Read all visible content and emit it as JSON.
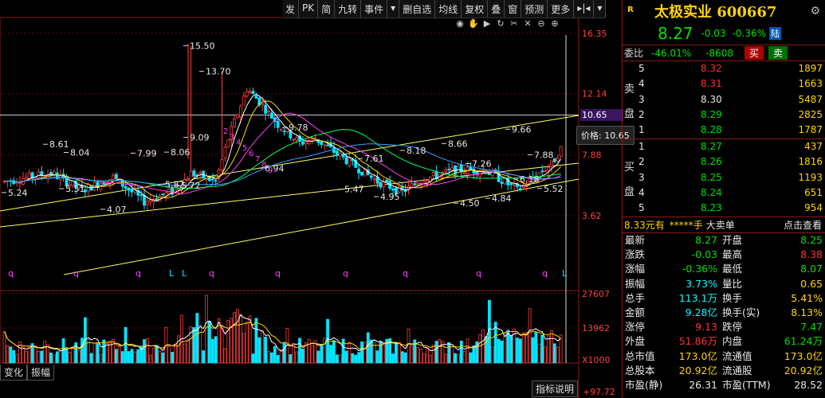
{
  "toolbar": {
    "items": [
      "发",
      "PK",
      "简",
      "九转",
      "事件",
      "▾",
      "删自选",
      "均线",
      "复权",
      "叠",
      "窗",
      "预测",
      "更多",
      "▸|◂",
      "▾"
    ]
  },
  "chart_icons": [
    "eye-icon",
    "hand-icon",
    "play-icon",
    "refresh-icon",
    "scissors-icon",
    "cross-icon",
    "zoom-out-icon",
    "zoom-in-icon"
  ],
  "chart_data": [
    {
      "type": "candlestick",
      "y_axis_labels": [
        "16.35",
        "12.14",
        "7.88",
        "3.62"
      ],
      "y_axis_values": [
        16.35,
        12.14,
        7.88,
        3.62
      ],
      "current_price": "10.65",
      "price_tooltip": "价格: 10.65",
      "annotations": [
        {
          "label": "15.50",
          "kind": "high"
        },
        {
          "label": "13.70",
          "kind": "high"
        },
        {
          "label": "8.61",
          "kind": "high"
        },
        {
          "label": "8.04",
          "kind": "high"
        },
        {
          "label": "7.99",
          "kind": "high"
        },
        {
          "label": "8.06",
          "kind": "high"
        },
        {
          "label": "9.09",
          "kind": "low"
        },
        {
          "label": "9.78",
          "kind": "high"
        },
        {
          "label": "8.18",
          "kind": "high"
        },
        {
          "label": "8.66",
          "kind": "high"
        },
        {
          "label": "9.66",
          "kind": "high"
        },
        {
          "label": "7.88",
          "kind": "high"
        },
        {
          "label": "7.61",
          "kind": "high"
        },
        {
          "label": "7.26",
          "kind": "high"
        },
        {
          "label": "6.94",
          "kind": "low"
        },
        {
          "label": "6.18",
          "kind": "low"
        },
        {
          "label": "5.24",
          "kind": "low"
        },
        {
          "label": "5.51",
          "kind": "low"
        },
        {
          "label": "5.82",
          "kind": "low"
        },
        {
          "label": "5.72",
          "kind": "low"
        },
        {
          "label": "5.47",
          "kind": "low"
        },
        {
          "label": "4.95",
          "kind": "low"
        },
        {
          "label": "5.52",
          "kind": "low"
        },
        {
          "label": "4.07",
          "kind": "low"
        },
        {
          "label": "4.50",
          "kind": "low"
        },
        {
          "label": "4.84",
          "kind": "low"
        }
      ],
      "bottom_markers": [
        "q",
        "q",
        "q",
        "L",
        "L",
        "q",
        "q",
        "q",
        "q",
        "q",
        "q",
        "L"
      ],
      "sequence_labels": [
        "2",
        "3",
        "4",
        "5",
        "6",
        "7",
        "8",
        "9"
      ]
    },
    {
      "type": "bar",
      "name": "volume",
      "y_axis_labels": [
        "27607",
        "13962",
        "X1000"
      ],
      "y_axis_values": [
        27607,
        13962,
        0
      ]
    }
  ],
  "bottom_tabs": [
    "变化",
    "振幅"
  ],
  "help_button": "指标说明",
  "bottom_right_value": "+97.72",
  "quote": {
    "badge": "R",
    "name": "太极实业 600667",
    "price": "8.27",
    "change": "-0.03",
    "change_pct": "-0.36%",
    "market_tag": "陆",
    "webi_label": "委比",
    "webi_pct": "-46.01%",
    "webi_diff": "-8608",
    "buy_label": "买",
    "sell_label": "卖",
    "sell_side_label": [
      "卖",
      "盘"
    ],
    "buy_side_label": [
      "买",
      "盘"
    ],
    "asks": [
      {
        "level": "5",
        "price": "8.32",
        "vol": "1897",
        "color": "r"
      },
      {
        "level": "4",
        "price": "8.31",
        "vol": "1663",
        "color": "r"
      },
      {
        "level": "3",
        "price": "8.30",
        "vol": "5487",
        "color": "w"
      },
      {
        "level": "2",
        "price": "8.29",
        "vol": "2825",
        "color": "g"
      },
      {
        "level": "1",
        "price": "8.28",
        "vol": "1787",
        "color": "g"
      }
    ],
    "bids": [
      {
        "level": "1",
        "price": "8.27",
        "vol": "437",
        "color": "g"
      },
      {
        "level": "2",
        "price": "8.26",
        "vol": "1816",
        "color": "g"
      },
      {
        "level": "3",
        "price": "8.25",
        "vol": "1193",
        "color": "g"
      },
      {
        "level": "4",
        "price": "8.24",
        "vol": "651",
        "color": "g"
      },
      {
        "level": "5",
        "price": "8.23",
        "vol": "954",
        "color": "g"
      }
    ],
    "trade_line": {
      "amount": "8.33元有",
      "hands": "*****手",
      "big_order": "大卖单",
      "click": "点击查看"
    },
    "stats": [
      {
        "k1": "最新",
        "v1": "8.27",
        "c1": "g",
        "k2": "开盘",
        "v2": "8.25",
        "c2": "g"
      },
      {
        "k1": "涨跌",
        "v1": "-0.03",
        "c1": "g",
        "k2": "最高",
        "v2": "8.38",
        "c2": "r"
      },
      {
        "k1": "涨幅",
        "v1": "-0.36%",
        "c1": "g",
        "k2": "最低",
        "v2": "8.07",
        "c2": "g"
      },
      {
        "k1": "振幅",
        "v1": "3.73%",
        "c1": "c",
        "k2": "量比",
        "v2": "0.65",
        "c2": "y"
      },
      {
        "k1": "总手",
        "v1": "113.1万",
        "c1": "c",
        "k2": "换手",
        "v2": "5.41%",
        "c2": "y"
      },
      {
        "k1": "金额",
        "v1": "9.28亿",
        "c1": "c",
        "k2": "换手(实)",
        "v2": "8.13%",
        "c2": "y"
      },
      {
        "k1": "涨停",
        "v1": "9.13",
        "c1": "r",
        "k2": "跌停",
        "v2": "7.47",
        "c2": "g"
      },
      {
        "k1": "外盘",
        "v1": "51.86万",
        "c1": "r",
        "k2": "内盘",
        "v2": "61.24万",
        "c2": "g"
      },
      {
        "k1": "总市值",
        "v1": "173.0亿",
        "c1": "y",
        "k2": "流通值",
        "v2": "173.0亿",
        "c2": "y"
      },
      {
        "k1": "总股本",
        "v1": "20.92亿",
        "c1": "y",
        "k2": "流通股",
        "v2": "20.92亿",
        "c2": "y"
      },
      {
        "k1": "市盈(静)",
        "v1": "26.31",
        "c1": "w",
        "k2": "市盈(TTM)",
        "v2": "28.52",
        "c2": "w"
      }
    ]
  }
}
